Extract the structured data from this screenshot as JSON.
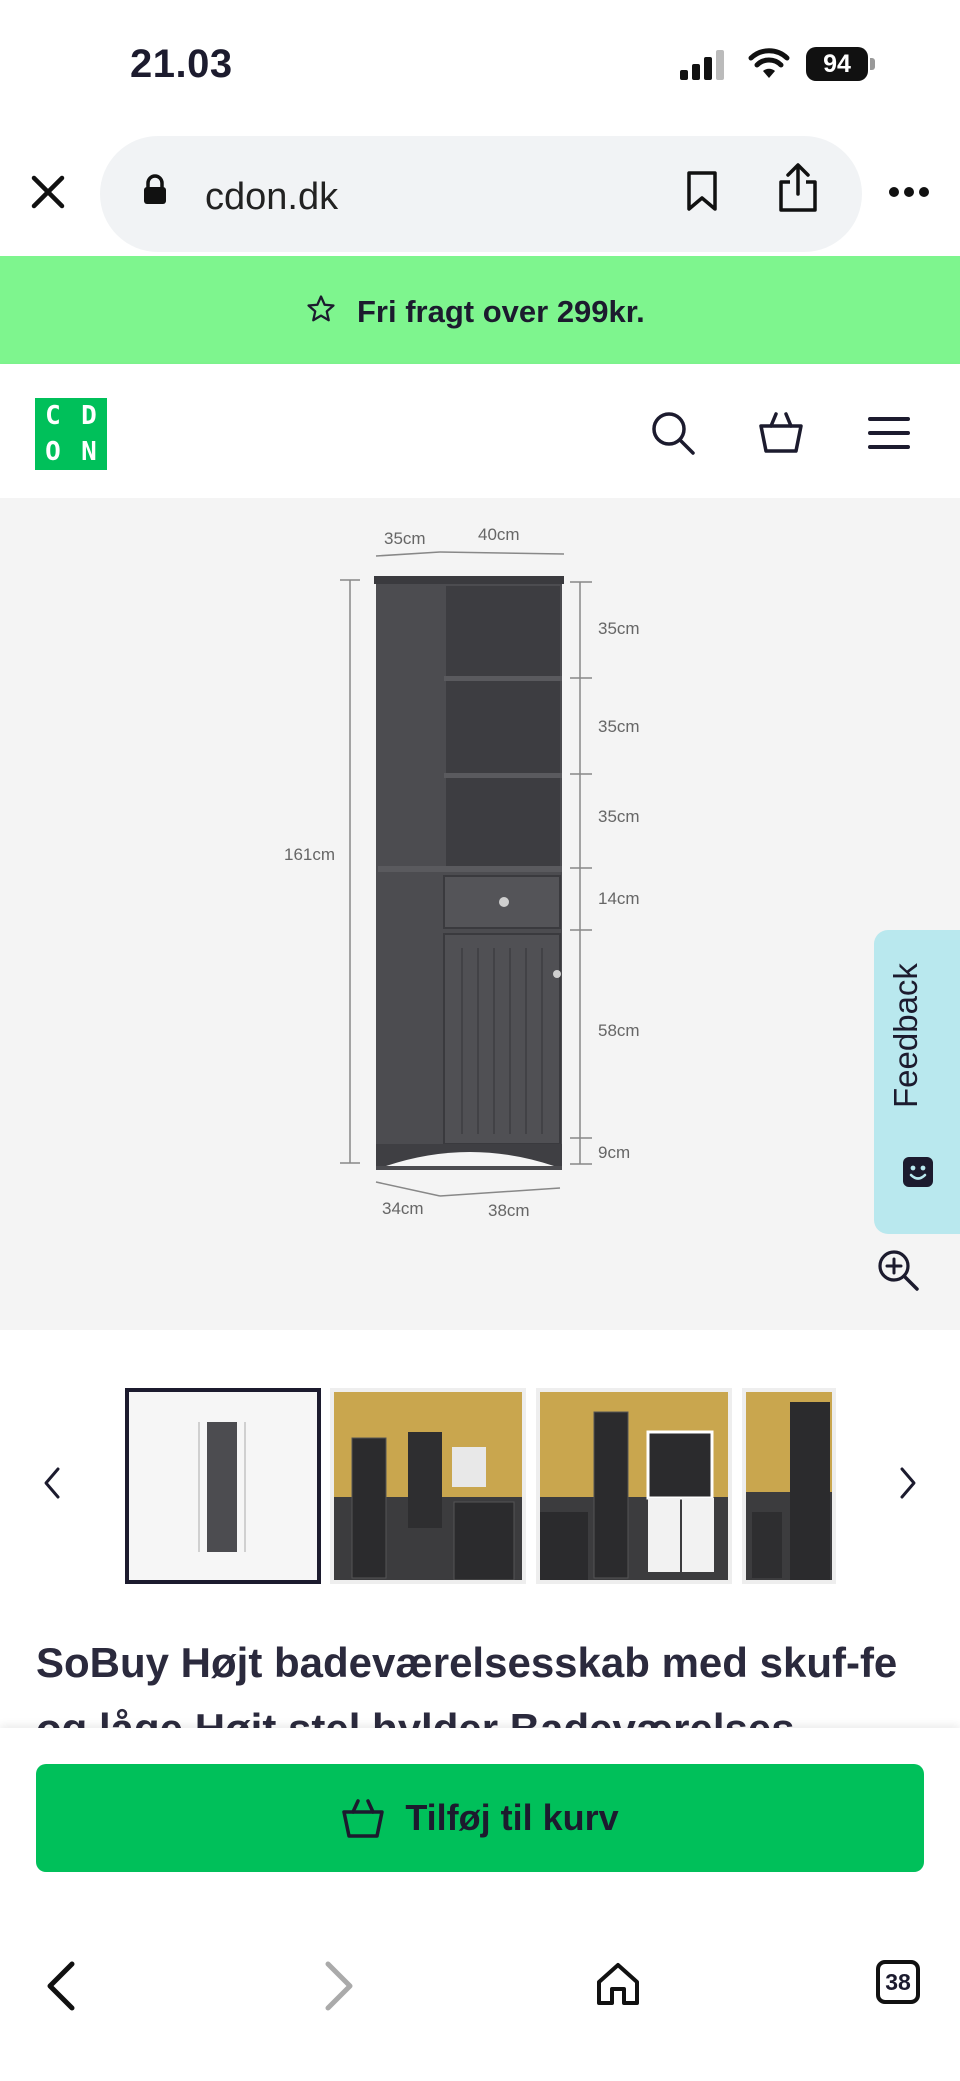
{
  "status_bar": {
    "time": "21.03",
    "battery": "94"
  },
  "browser": {
    "url": "cdon.dk",
    "tabs_count": "38"
  },
  "promo": {
    "text": "Fri fragt over 299kr."
  },
  "header": {
    "logo_letters": [
      "C",
      "D",
      "O",
      "N"
    ]
  },
  "product_image": {
    "dimension_labels": {
      "top_depth": "35cm",
      "top_width": "40cm",
      "height": "161cm",
      "shelf_1": "35cm",
      "shelf_2": "35cm",
      "shelf_3": "35cm",
      "drawer": "14cm",
      "cabinet": "58cm",
      "base": "9cm",
      "bottom_depth": "34cm",
      "bottom_width": "38cm"
    }
  },
  "feedback": {
    "label": "Feedback"
  },
  "product": {
    "title": "SoBuy Højt badeværelsesskab med skuf-fe og låge Højt stel hylder Badeværelses-"
  },
  "cart": {
    "add_label": "Tilføj til kurv"
  },
  "colors": {
    "brand_green": "#00c05a",
    "promo_green": "#7ef58e",
    "feedback_bg": "#b9e8ee",
    "text_dark": "#1c1b2e"
  }
}
